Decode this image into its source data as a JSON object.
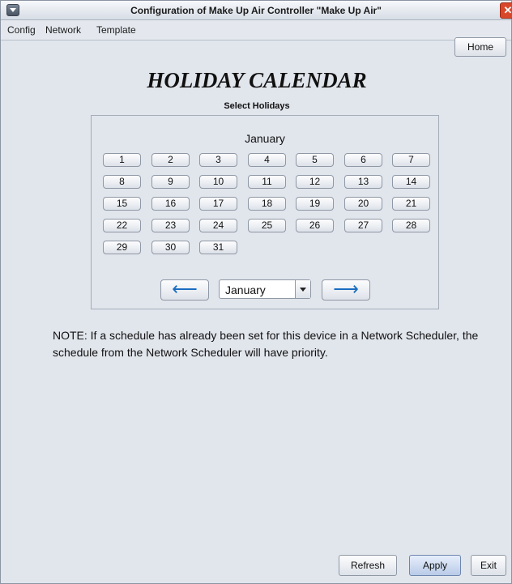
{
  "window": {
    "title": "Configuration of Make Up Air Controller \"Make Up Air\"",
    "close_glyph": "✕"
  },
  "menubar": {
    "items": [
      "Config",
      "Network",
      "Template"
    ],
    "home_label": "Home"
  },
  "page": {
    "heading": "HOLIDAY CALENDAR",
    "subheading": "Select Holidays"
  },
  "calendar": {
    "month": "January",
    "days": [
      "1",
      "2",
      "3",
      "4",
      "5",
      "6",
      "7",
      "8",
      "9",
      "10",
      "11",
      "12",
      "13",
      "14",
      "15",
      "16",
      "17",
      "18",
      "19",
      "20",
      "21",
      "22",
      "23",
      "24",
      "25",
      "26",
      "27",
      "28",
      "29",
      "30",
      "31"
    ],
    "prev_glyph": "⟵",
    "next_glyph": "⟶",
    "selected_month": "January",
    "icons": {
      "prev": "arrow-left-icon",
      "next": "arrow-right-icon"
    }
  },
  "note": "NOTE: If a schedule has already been set for this device in a Network Scheduler, the schedule from the Network Scheduler will have priority.",
  "footer": {
    "refresh_label": "Refresh",
    "apply_label": "Apply",
    "exit_label": "Exit"
  },
  "colors": {
    "window_bg": "#e1e5ec",
    "close_button": "#d9472b",
    "arrow": "#1a6cc0"
  }
}
